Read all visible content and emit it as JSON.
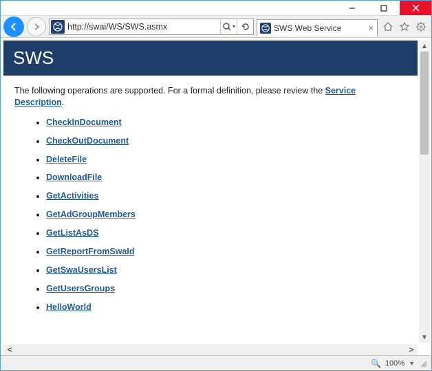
{
  "browser": {
    "url": "http://swai/WS/SWS.asmx",
    "tab_title": "SWS Web Service",
    "zoom": "100%"
  },
  "page": {
    "heading": "SWS",
    "intro_prefix": "The following operations are supported. For a formal definition, please review the ",
    "service_desc_link": "Service Description",
    "intro_suffix": ".",
    "operations": [
      "CheckInDocument",
      "CheckOutDocument",
      "DeleteFile",
      "DownloadFile",
      "GetActivities",
      "GetAdGroupMembers",
      "GetListAsDS",
      "GetReportFromSwaId",
      "GetSwaUsersList",
      "GetUsersGroups",
      "HelloWorld"
    ]
  }
}
